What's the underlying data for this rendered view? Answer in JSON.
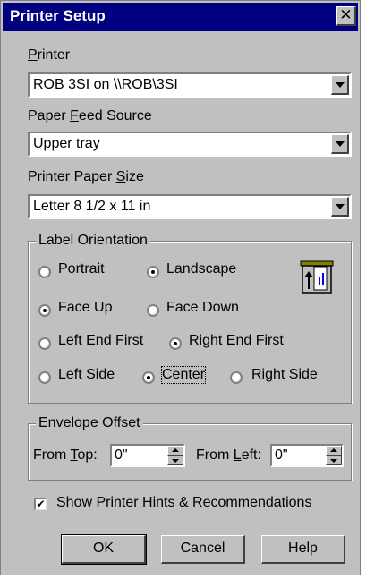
{
  "window": {
    "title": "Printer Setup",
    "close_glyph": "✕"
  },
  "printer": {
    "label": "Printer",
    "value": "ROB 3SI on \\\\ROB\\3SI"
  },
  "paper_feed": {
    "label": "Paper Feed Source",
    "value": "Upper tray"
  },
  "paper_size": {
    "label": "Printer Paper Size",
    "value": "Letter 8 1/2 x 11 in"
  },
  "orientation": {
    "title": "Label Orientation",
    "portrait": "Portrait",
    "landscape": "Landscape",
    "face_up": "Face Up",
    "face_down": "Face Down",
    "left_end_first": "Left End First",
    "right_end_first": "Right End First",
    "left_side": "Left Side",
    "center": "Center",
    "right_side": "Right Side",
    "selected": [
      "landscape",
      "face_up",
      "right_end_first",
      "center"
    ],
    "icon": "printer-feed-icon"
  },
  "envelope": {
    "title": "Envelope Offset",
    "from_top_label": "From Top:",
    "from_top_value": "0\"",
    "from_left_label": "From Left:",
    "from_left_value": "0\""
  },
  "hints": {
    "label": "Show Printer Hints & Recommendations",
    "checked": true
  },
  "buttons": {
    "ok": "OK",
    "cancel": "Cancel",
    "help": "Help"
  },
  "colors": {
    "titlebar": "#000080",
    "face": "#c0c0c0"
  }
}
